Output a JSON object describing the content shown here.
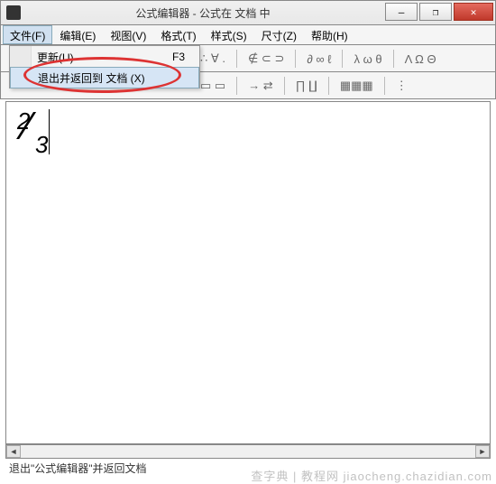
{
  "window": {
    "title": "公式编辑器 - 公式在 文档 中",
    "min": "—",
    "max": "❐",
    "close": "✕"
  },
  "menubar": {
    "file": "文件(F)",
    "edit": "编辑(E)",
    "view": "视图(V)",
    "format": "格式(T)",
    "style": "样式(S)",
    "size": "尺寸(Z)",
    "help": "帮助(H)"
  },
  "dropdown": {
    "update": {
      "label": "更新(U)",
      "shortcut": "F3"
    },
    "exit": {
      "label": "退出并返回到 文档 (X)"
    }
  },
  "toolbar_visible": {
    "g1": "∴ ∀ .",
    "g2": "∉ ⊂ ⊃",
    "g3": "∂ ∞ ℓ",
    "g4": "λ ω θ",
    "g5": "Λ Ω Θ"
  },
  "toolbar2_visible": {
    "g1": "▭  ▭",
    "g2": "→ ⇄",
    "g3": "∏  ∐",
    "g4": "▦▦▦",
    "g5": "⋮"
  },
  "canvas": {
    "numerator": "2",
    "denominator": "3"
  },
  "statusbar": {
    "text": "退出\"公式编辑器\"并返回文档"
  },
  "scroll": {
    "left": "◄",
    "right": "►"
  },
  "watermark": "查字典 | 教程网  jiaocheng.chazidian.com"
}
